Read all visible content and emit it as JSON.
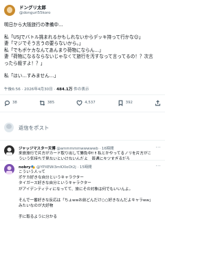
{
  "tweet": {
    "author_name": "ドングリ太郎",
    "author_handle": "@donguri55koro",
    "text_lines": [
      "明日から大阪旅行の準備中…",
      "",
      "私「USJでバトル挑まれるかもしれないからデッキ持って行かな😊」",
      "妻「マジでそう言うの要らないから。」",
      "私「でもポケカなんてあんまり荷物にならん…」",
      "妻「荷物になるならないじゃなくて旅行を汚すなって言ってるの！？次言",
      "ったら殺すよ！？」",
      "",
      "私「はい…すみません…」"
    ],
    "time": "午後6:56 · 2026年4月30日 · ",
    "views_count": "484.1万",
    "views_label": " 件の表示"
  },
  "actions": {
    "reply_count": "38",
    "retweet_count": "385",
    "like_count": "4,537",
    "bookmark_count": "392"
  },
  "compose": {
    "placeholder": "返信をポスト"
  },
  "replies": [
    {
      "name": "ジャッジマスター天博",
      "handle": "@ammmmmwwwwwb · 16時間",
      "lines": [
        "来旅旅行で片方がカード取り出して勝負中‼ ‼ 私とかやってるノリを片方がこ",
        "ういう気持ちで見ないといけないんだよ　普通にキツすぎるだろ"
      ],
      "avatar_color": "#2b2b2b"
    },
    {
      "name": "nobry🎭",
      "handle": "@YPXEWi3mKXloOt2j · 15時間",
      "lines": [
        "こういう人って",
        "ポケカ好きな自分というキャラクター",
        "タイガース好きな自分というキャラクター",
        "がアイデンティティになってて、旅にその対象は何でもいいんよ。",
        "",
        "そんで一番好きな反応は「ちょwwお前どんだけ○○好きなんだよキャラww」",
        "みたいなのが大好物",
        "",
        "手に取るように分かる"
      ],
      "avatar_color": "#7a4fb0"
    }
  ]
}
